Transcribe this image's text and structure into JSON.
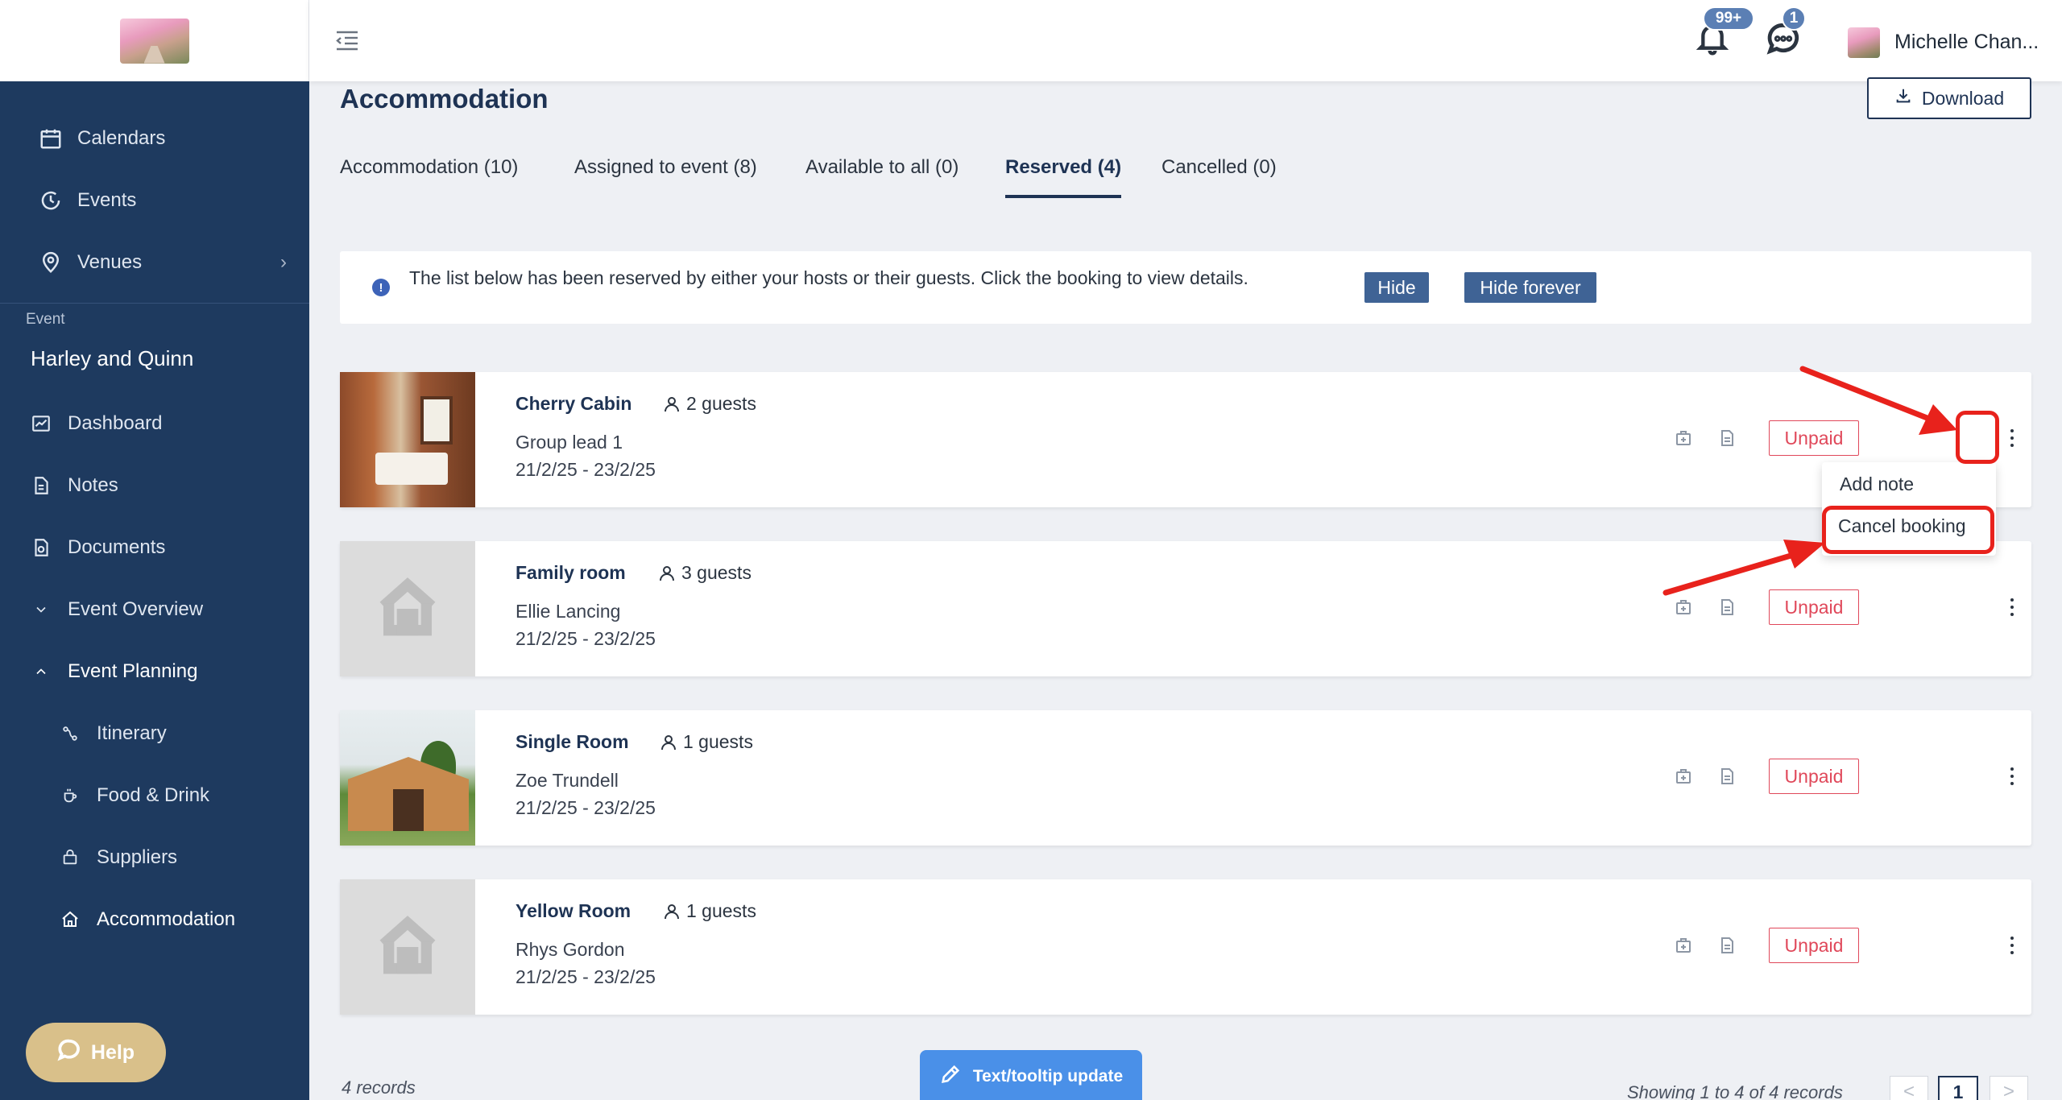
{
  "header": {
    "notifications_badge": "99+",
    "messages_badge": "1",
    "user_name": "Michelle Chan..."
  },
  "sidebar": {
    "top_items": [
      {
        "label": "Calendars",
        "icon": "calendar-icon"
      },
      {
        "label": "Events",
        "icon": "events-icon"
      },
      {
        "label": "Venues",
        "icon": "location-pin-icon"
      }
    ],
    "event_caption": "Event",
    "event_name": "Harley and Quinn",
    "event_items": [
      {
        "label": "Dashboard",
        "icon": "dashboard-icon"
      },
      {
        "label": "Notes",
        "icon": "notes-icon"
      },
      {
        "label": "Documents",
        "icon": "documents-icon"
      },
      {
        "label": "Event Overview",
        "icon": "chevron-down-icon"
      },
      {
        "label": "Event Planning",
        "icon": "chevron-up-icon"
      }
    ],
    "sub_items": [
      {
        "label": "Itinerary",
        "icon": "itinerary-icon"
      },
      {
        "label": "Food & Drink",
        "icon": "coffee-icon"
      },
      {
        "label": "Suppliers",
        "icon": "suppliers-icon"
      },
      {
        "label": "Accommodation",
        "icon": "home-icon"
      }
    ],
    "help_label": "Help"
  },
  "main": {
    "title": "Accommodation",
    "download_label": "Download",
    "tabs": [
      {
        "label": "Accommodation (10)"
      },
      {
        "label": "Assigned to event (8)"
      },
      {
        "label": "Available to all (0)"
      },
      {
        "label": "Reserved (4)",
        "active": true
      },
      {
        "label": "Cancelled (0)"
      }
    ],
    "info": {
      "text": "The list below has been reserved by either your hosts or their guests. Click the booking to view details.",
      "hide_label": "Hide",
      "hide_forever_label": "Hide forever"
    },
    "bookings": [
      {
        "name": "Cherry Cabin",
        "guests": "2 guests",
        "lead": "Group lead 1",
        "dates": "21/2/25 - 23/2/25",
        "status": "Unpaid"
      },
      {
        "name": "Family room",
        "guests": "3 guests",
        "lead": "Ellie Lancing",
        "dates": "21/2/25 - 23/2/25",
        "status": "Unpaid"
      },
      {
        "name": "Single Room",
        "guests": "1 guests",
        "lead": "Zoe Trundell",
        "dates": "21/2/25 - 23/2/25",
        "status": "Unpaid"
      },
      {
        "name": "Yellow Room",
        "guests": "1 guests",
        "lead": "Rhys Gordon",
        "dates": "21/2/25 - 23/2/25",
        "status": "Unpaid"
      }
    ],
    "menu": {
      "add_note": "Add note",
      "cancel_booking": "Cancel booking"
    },
    "footer": {
      "records": "4 records",
      "showing": "Showing 1 to 4 of 4 records",
      "page": "1",
      "prev": "<",
      "next": ">"
    },
    "tooltip_button": "Text/tooltip update"
  },
  "colors": {
    "sidebar_bg": "#1e3a5f",
    "primary": "#1e3354",
    "unpaid": "#e0485a",
    "annotation": "#e8221c",
    "help_bg": "#d9c08a",
    "tooltip_bg": "#4a90e8"
  }
}
